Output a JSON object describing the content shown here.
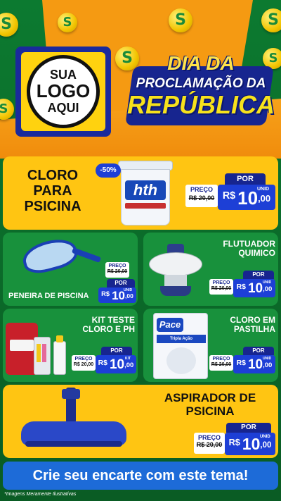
{
  "logo": {
    "line1": "SUA",
    "line2": "LOGO",
    "line3": "AQUI"
  },
  "title": {
    "line1": "DIA DA",
    "line2": "PROCLAMAÇÃO DA",
    "line3": "REPÚBLICA"
  },
  "coin_symbol": "S",
  "colors": {
    "green": "#18913c",
    "yellow": "#ffc512",
    "blue": "#1d3fd6",
    "navy": "#17258f"
  },
  "products": {
    "cloro": {
      "name_l1": "CLORO",
      "name_l2": "PARA",
      "name_l3": "PSICINA",
      "discount": "-50%",
      "por": "POR",
      "preco": "PREÇO",
      "old": "R$ 20,00",
      "rs": "R$",
      "price": "10",
      "dec": ",00",
      "unit": "UNID",
      "brand": "hth"
    },
    "peneira": {
      "name": "PENEIRA DE PISCINA",
      "por": "POR",
      "preco": "PREÇO",
      "old": "R$ 20,00",
      "rs": "R$",
      "price": "10",
      "dec": ",00",
      "unit": "UNID"
    },
    "flutuador": {
      "name_l1": "FLUTUADOR",
      "name_l2": "QUIMICO",
      "por": "POR",
      "preco": "PREÇO",
      "old": "R$ 20,00",
      "rs": "R$",
      "price": "10",
      "dec": ",00",
      "unit": "UNID"
    },
    "kit": {
      "name_l1": "KIT TESTE",
      "name_l2": "CLORO E PH",
      "por": "POR",
      "preco": "PREÇO",
      "old": "R$ 20,00",
      "rs": "R$",
      "price": "10",
      "dec": ",00",
      "unit": "KIT"
    },
    "pastilha": {
      "name_l1": "CLORO EM",
      "name_l2": "PASTILHA",
      "por": "POR",
      "preco": "PREÇO",
      "old": "R$ 20,00",
      "rs": "R$",
      "price": "10",
      "dec": ",00",
      "unit": "UNID",
      "brand": "Pace",
      "brand_sub": "Tripla Ação"
    },
    "aspirador": {
      "name_l1": "ASPIRADOR DE",
      "name_l2": "PSICINA",
      "por": "POR",
      "preco": "PREÇO",
      "old": "R$ 20,00",
      "rs": "R$",
      "price": "10",
      "dec": ",00",
      "unit": "UNID"
    }
  },
  "cta": "Crie seu encarte com este tema!",
  "footnote": "*Imagens Meramente Ilustrativas"
}
